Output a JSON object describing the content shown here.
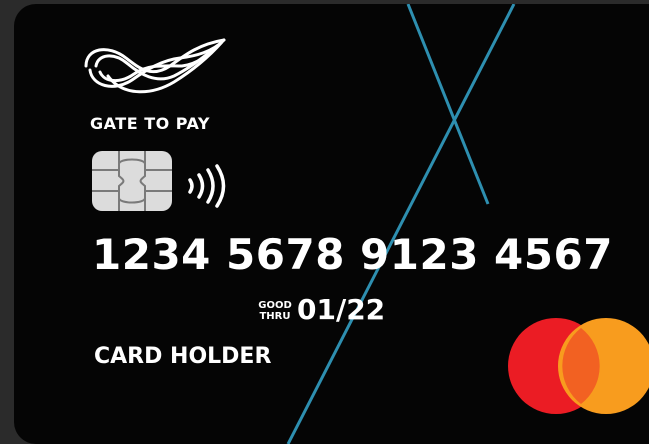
{
  "card": {
    "brand": "GATE TO PAY",
    "number": "1234 5678 9123 4567",
    "good_thru_label": "GOOD\nTHRU",
    "expiry": "01/22",
    "holder": "CARD HOLDER"
  },
  "icons": {
    "logo": "infinity-logo-icon",
    "chip": "emv-chip-icon",
    "contactless": "contactless-icon",
    "network": "mastercard-logo-icon"
  },
  "colors": {
    "card_background": "#050505",
    "accent_lines": "#2e8fb0",
    "mastercard_red": "#eb1c24",
    "mastercard_orange": "#f89c1e",
    "mastercard_overlap": "#f26122",
    "chip": "#dcdcdc"
  }
}
